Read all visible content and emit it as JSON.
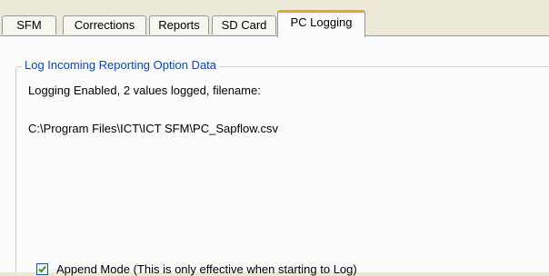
{
  "tabs": [
    {
      "label": "SFM"
    },
    {
      "label": "Corrections"
    },
    {
      "label": "Reports"
    },
    {
      "label": "SD Card"
    },
    {
      "label": "PC Logging",
      "active": true
    }
  ],
  "group": {
    "title": "Log Incoming Reporting Option Data",
    "status": "Logging Enabled, 2 values logged, filename:",
    "filename": "C:\\Program Files\\ICT\\ICT SFM\\PC_Sapflow.csv"
  },
  "append": {
    "label": "Append Mode (This is only effective when starting to Log)",
    "checked": true
  },
  "colors": {
    "accent_tab": "#e8a33a",
    "group_title": "#0046d5",
    "check": "#21a121"
  }
}
